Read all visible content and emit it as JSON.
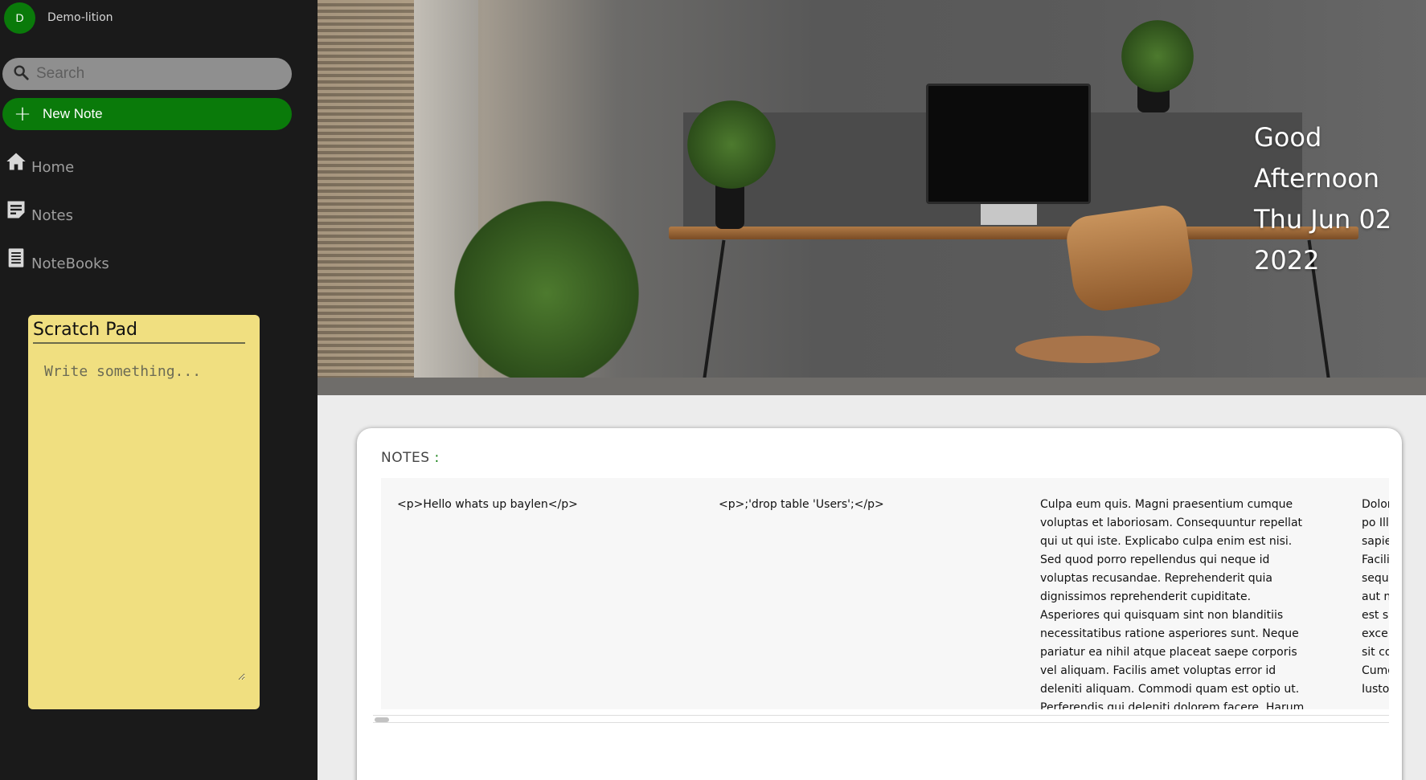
{
  "user": {
    "initial": "D",
    "name": "Demo-lition"
  },
  "search": {
    "placeholder": "Search",
    "value": ""
  },
  "new_note": {
    "label": "New Note"
  },
  "nav": [
    {
      "label": "Home",
      "icon": "home-icon"
    },
    {
      "label": "Notes",
      "icon": "note-icon"
    },
    {
      "label": "NoteBooks",
      "icon": "notebook-icon"
    }
  ],
  "scratch_pad": {
    "title": "Scratch Pad",
    "placeholder": "Write something..."
  },
  "hero": {
    "greeting": "Good Afternoon",
    "date": "Thu Jun 02 2022"
  },
  "notes_section": {
    "title": "NOTES",
    "colon": ":",
    "notes": [
      {
        "text": "<p>Hello whats up baylen</p>"
      },
      {
        "text": "<p>;'drop table 'Users';</p>"
      },
      {
        "text": "Culpa eum quis. Magni praesentium cumque voluptas et laboriosam. Consequuntur repellat qui ut qui iste. Explicabo culpa enim est nisi. Sed quod porro repellendus qui neque id voluptas recusandae. Reprehenderit quia dignissimos reprehenderit cupiditate. Asperiores qui quisquam sint non blanditiis necessitatibus ratione asperiores sunt. Neque pariatur ea nihil atque placeat saepe corporis vel aliquam. Facilis amet voluptas error id deleniti aliquam. Commodi quam est optio ut. Perferendis qui deleniti dolorem facere. Harum laborum perspiciatis. Totam ad nulla qui. Est asperatur ab sit quia qui"
      },
      {
        "text": "Dolor et po Illum sapie Facili sequi aut n est si excep sit co Cumq Iusto"
      }
    ]
  },
  "colors": {
    "sidebar_bg": "#1a1a1a",
    "accent_green": "#0a7a0a",
    "scratch_bg": "#f0df80"
  }
}
